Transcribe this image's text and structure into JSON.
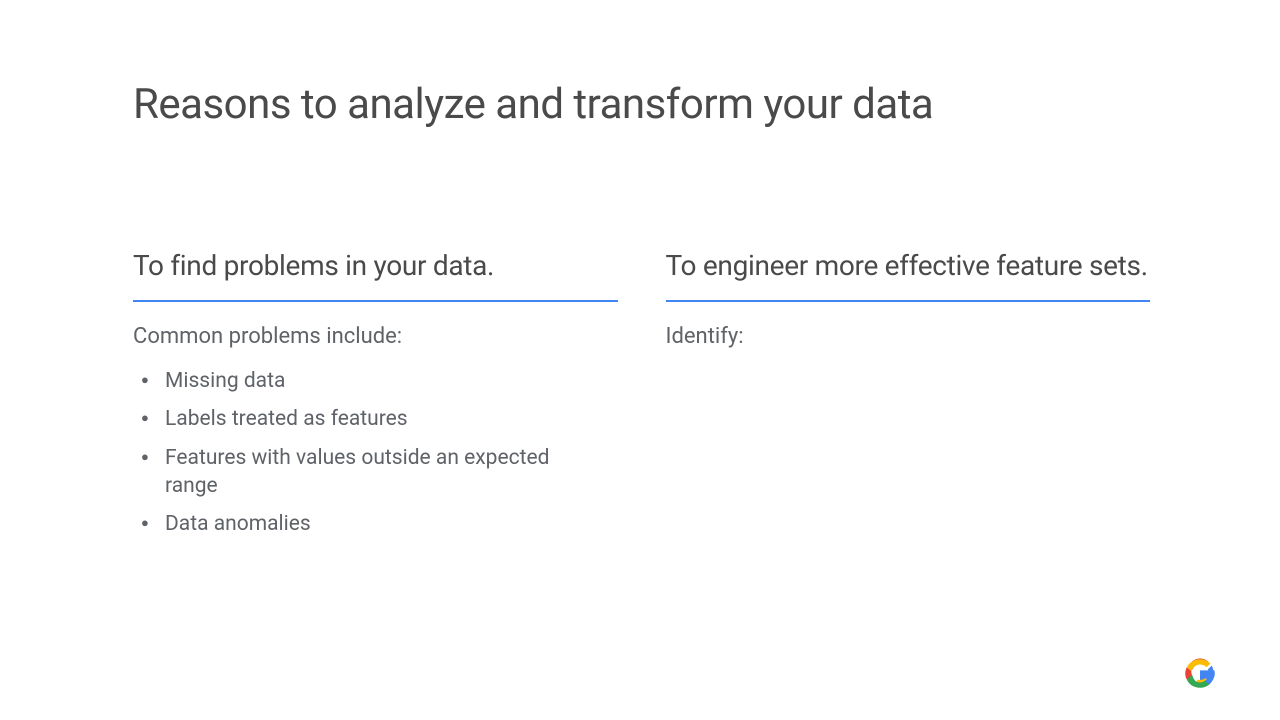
{
  "title": "Reasons to analyze and transform your data",
  "left": {
    "heading": "To find problems in your data.",
    "subheading": "Common problems include:",
    "bullets": [
      "Missing data",
      "Labels treated as features",
      "Features with values outside an expected range",
      "Data anomalies"
    ]
  },
  "right": {
    "heading": "To engineer more effective feature sets.",
    "subheading": "Identify:"
  }
}
